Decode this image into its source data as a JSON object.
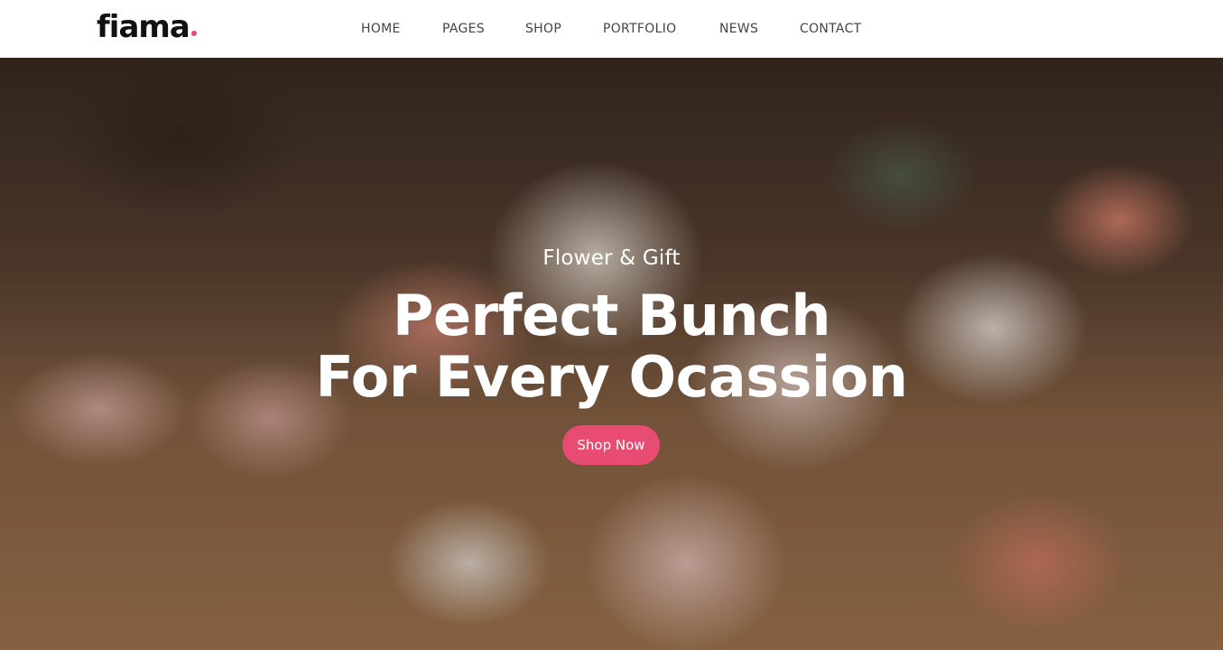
{
  "brand": {
    "logo_text": "fiama",
    "dot_color": "#e8486a"
  },
  "nav": {
    "items": [
      {
        "label": "HOME"
      },
      {
        "label": "PAGES"
      },
      {
        "label": "SHOP"
      },
      {
        "label": "PORTFOLIO"
      },
      {
        "label": "NEWS"
      },
      {
        "label": "CONTACT"
      }
    ]
  },
  "hero": {
    "eyebrow": "Flower & Gift",
    "title_line1": "Perfect Bunch",
    "title_line2": "For Every Ocassion",
    "button_label": "Shop Now",
    "button_color": "#e84c72"
  }
}
